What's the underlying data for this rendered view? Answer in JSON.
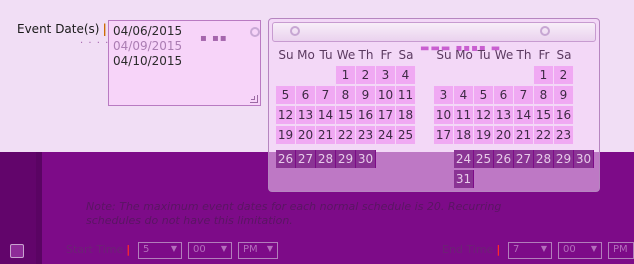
{
  "event_date": {
    "label": "Event Date(s)",
    "required_marker": "|",
    "lines": [
      "04/06/2015",
      "04/09/2015",
      "04/10/2015"
    ]
  },
  "calendar": {
    "left": {
      "weekdays": [
        "Su",
        "Mo",
        "Tu",
        "We",
        "Th",
        "Fr",
        "Sa"
      ],
      "days": [
        "",
        "",
        "",
        "1",
        "2",
        "3",
        "4",
        "5",
        "6",
        "7",
        "8",
        "9",
        "10",
        "11",
        "12",
        "13",
        "14",
        "15",
        "16",
        "17",
        "18",
        "19",
        "20",
        "21",
        "22",
        "23",
        "24",
        "25"
      ]
    },
    "right": {
      "weekdays": [
        "Su",
        "Mo",
        "Tu",
        "We",
        "Th",
        "Fr",
        "Sa"
      ],
      "days": [
        "",
        "",
        "",
        "",
        "",
        "1",
        "2",
        "3",
        "4",
        "5",
        "6",
        "7",
        "8",
        "9",
        "10",
        "11",
        "12",
        "13",
        "14",
        "15",
        "16",
        "17",
        "18",
        "19",
        "20",
        "21",
        "22",
        "23"
      ]
    },
    "lower_left_days": [
      "26",
      "27",
      "28",
      "29",
      "30"
    ],
    "lower_right_days": [
      "24",
      "25",
      "26",
      "27",
      "28",
      "29",
      "30",
      "31"
    ]
  },
  "note": "Note: The maximum event dates for each normal schedule is 20. Recurring schedules do not have this limitation.",
  "start_time": {
    "label": "Start Time",
    "required_marker": "|",
    "hour": "5",
    "minute": "00",
    "ampm": "PM"
  },
  "end_time": {
    "label": "End Time",
    "required_marker": "|",
    "hour": "7",
    "minute": "00",
    "ampm": "PM"
  }
}
